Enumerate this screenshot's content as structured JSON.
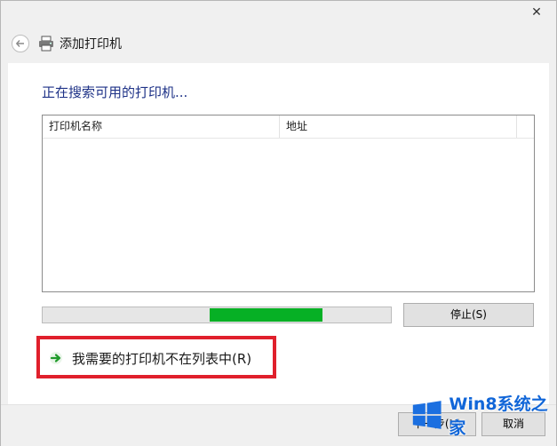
{
  "window": {
    "title": "添加打印机"
  },
  "content": {
    "heading": "正在搜索可用的打印机...",
    "columns": [
      "打印机名称",
      "地址"
    ],
    "progress_fraction": 0.325
  },
  "buttons": {
    "stop": "停止(S)",
    "next": "下一步(N)",
    "cancel": "取消"
  },
  "link": {
    "not_listed": "我需要的打印机不在列表中(R)"
  },
  "watermark": {
    "text": "Win8系统之家"
  },
  "colors": {
    "progress": "#06b025",
    "highlight": "#e0202c",
    "heading": "#1e3287",
    "watermark": "#1166d8"
  }
}
